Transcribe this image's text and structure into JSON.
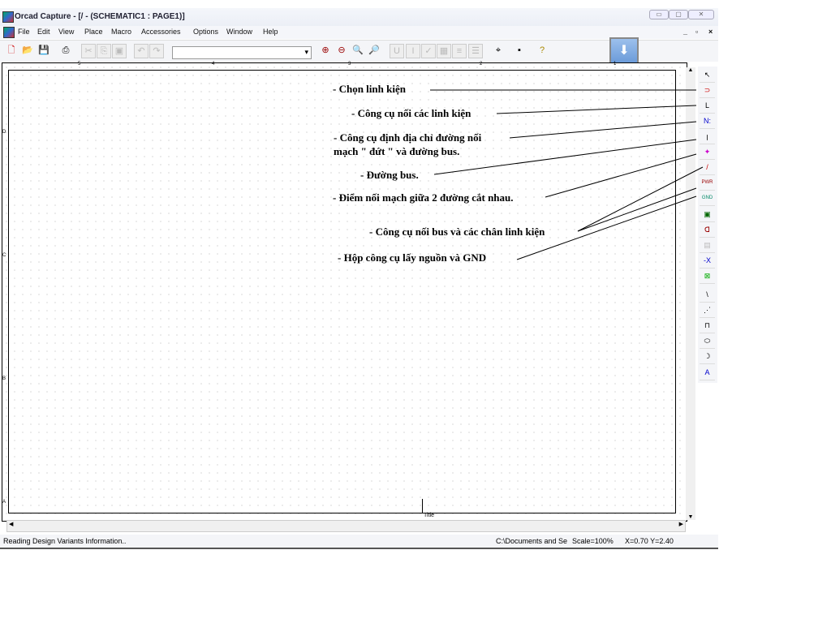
{
  "window": {
    "title": "Orcad Capture - [/ - (SCHEMATIC1 : PAGE1)]"
  },
  "menu": [
    "File",
    "Edit",
    "View",
    "Place",
    "Macro",
    "Accessories",
    "Options",
    "Window",
    "Help"
  ],
  "canvas": {
    "ruler_top": [
      "5",
      "4",
      "3",
      "2",
      "1"
    ],
    "ruler_left": [
      "D",
      "C",
      "B",
      "A"
    ],
    "title_label": "Title"
  },
  "status": {
    "message": "Reading Design Variants Information..",
    "path": "C:\\Documents and Se",
    "scale": "Scale=100%",
    "coords": "X=0.70  Y=2.40"
  },
  "annotations": [
    "- Chọn linh kiện",
    "- Công cụ nối các linh kiện",
    "- Công cụ định địa chỉ đường nối",
    "mạch \" đứt \" và đường bus.",
    "- Đường bus.",
    "- Điểm nối mạch giữa 2 đường cắt nhau.",
    "- Công cụ nối bus và các chân linh kiện",
    "- Hộp công cụ lấy nguồn và GND"
  ],
  "palette": [
    "↖",
    "⊃",
    "L",
    "N:",
    "ꞁ",
    "✦",
    "/",
    "PWR",
    "GND",
    "▣",
    "ᗡ",
    "▤",
    "-X",
    "⊠",
    "\\",
    "⋰",
    "⊓",
    "⬭",
    "☽",
    "A"
  ]
}
